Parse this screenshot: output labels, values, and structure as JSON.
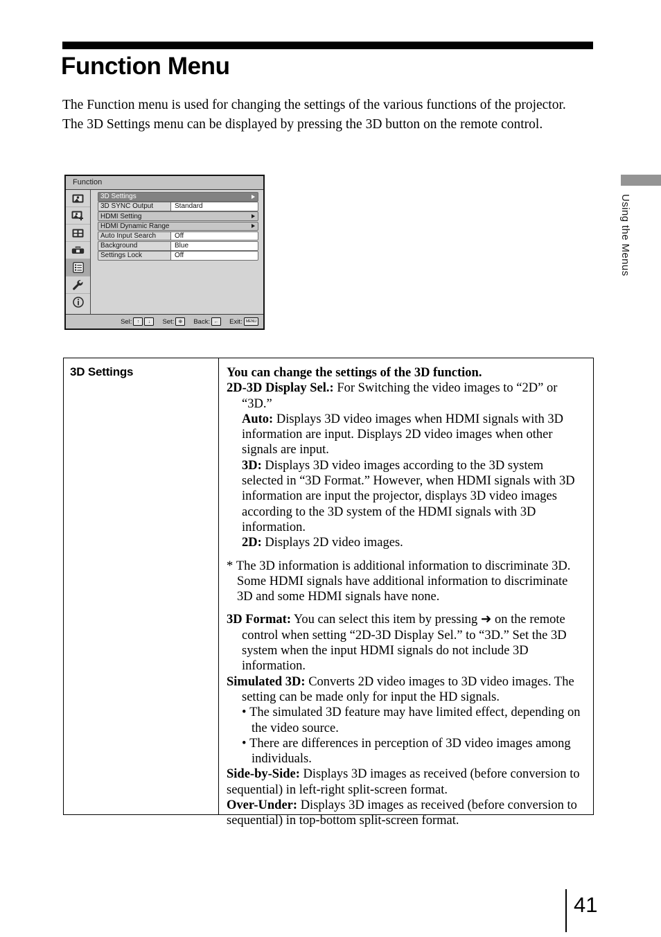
{
  "header": {
    "title": "Function Menu"
  },
  "intro": {
    "line1": "The Function menu is used for changing the settings of the various functions of the projector.",
    "line2": "The 3D Settings menu can be displayed by pressing the 3D button on the remote control."
  },
  "osd": {
    "title": "Function",
    "sidebar_icons": [
      "picture-icon",
      "picture-adjust-icon",
      "screen-icon",
      "toolbox-icon",
      "function-list-icon",
      "wrench-installation-icon",
      "information-icon"
    ],
    "active_sidebar_index": 4,
    "items": [
      {
        "label": "3D Settings",
        "value": "",
        "arrow": true,
        "selected": true,
        "submenu": true
      },
      {
        "label": "3D SYNC Output",
        "value": "Standard",
        "arrow": false,
        "selected": false,
        "submenu": false
      },
      {
        "label": "HDMI Setting",
        "value": "",
        "arrow": true,
        "selected": false,
        "submenu": true
      },
      {
        "label": "HDMI Dynamic Range",
        "value": "",
        "arrow": true,
        "selected": false,
        "submenu": true
      },
      {
        "label": "Auto Input Search",
        "value": "Off",
        "arrow": false,
        "selected": false,
        "submenu": false
      },
      {
        "label": "Background",
        "value": "Blue",
        "arrow": false,
        "selected": false,
        "submenu": false
      },
      {
        "label": "Settings Lock",
        "value": "Off",
        "arrow": false,
        "selected": false,
        "submenu": false
      }
    ],
    "hints": {
      "sel_label": "Sel:",
      "sel_key_up": "↑",
      "sel_key_down": "↓",
      "set_label": "Set:",
      "set_key": "⊕",
      "back_label": "Back:",
      "back_key": "←",
      "exit_label": "Exit:",
      "exit_key": "MENU"
    }
  },
  "side_tab": {
    "label": "Using the Menus",
    "color": "#949494"
  },
  "table": {
    "term": "3D Settings",
    "intro_bold": "You can change the settings of the 3D function.",
    "display_sel_label": "2D-3D Display Sel.:",
    "display_sel_text": " For Switching the video images to “2D” or “3D.”",
    "auto_label": "Auto:",
    "auto_text": " Displays 3D video images when HDMI signals with 3D information are input. Displays 2D video images when other signals are input.",
    "threed_label": "3D:",
    "threed_text": " Displays 3D video images according to the 3D system selected in “3D Format.” However, when HDMI signals with 3D information are input the projector, displays 3D video images according to the 3D system of the HDMI signals with 3D information.",
    "twod_label": "2D:",
    "twod_text": " Displays 2D video images.",
    "note_marker": "*",
    "note_text": "The 3D information is additional information to discriminate 3D. Some HDMI signals have additional information to discriminate 3D and some HDMI signals have none.",
    "format_label": "3D Format:",
    "format_text": " You can select this item by pressing ➜ on the remote control when setting “2D-3D Display Sel.” to “3D.” Set the 3D system when the input HDMI signals do not include 3D information.",
    "simulated_label": "Simulated 3D:",
    "simulated_text": " Converts 2D video images to 3D video images. The setting can be made only for input the HD signals.",
    "bullet1": "The simulated 3D feature may have limited effect, depending on the video source.",
    "bullet2": "There are differences in perception of 3D video images among individuals.",
    "sbs_label": "Side-by-Side:",
    "sbs_text": " Displays 3D images as received (before conversion to sequential) in left-right split-screen format.",
    "ou_label": "Over-Under:",
    "ou_text": " Displays 3D images as received (before conversion to sequential) in top-bottom split-screen format."
  },
  "footer": {
    "page_number": "41"
  }
}
